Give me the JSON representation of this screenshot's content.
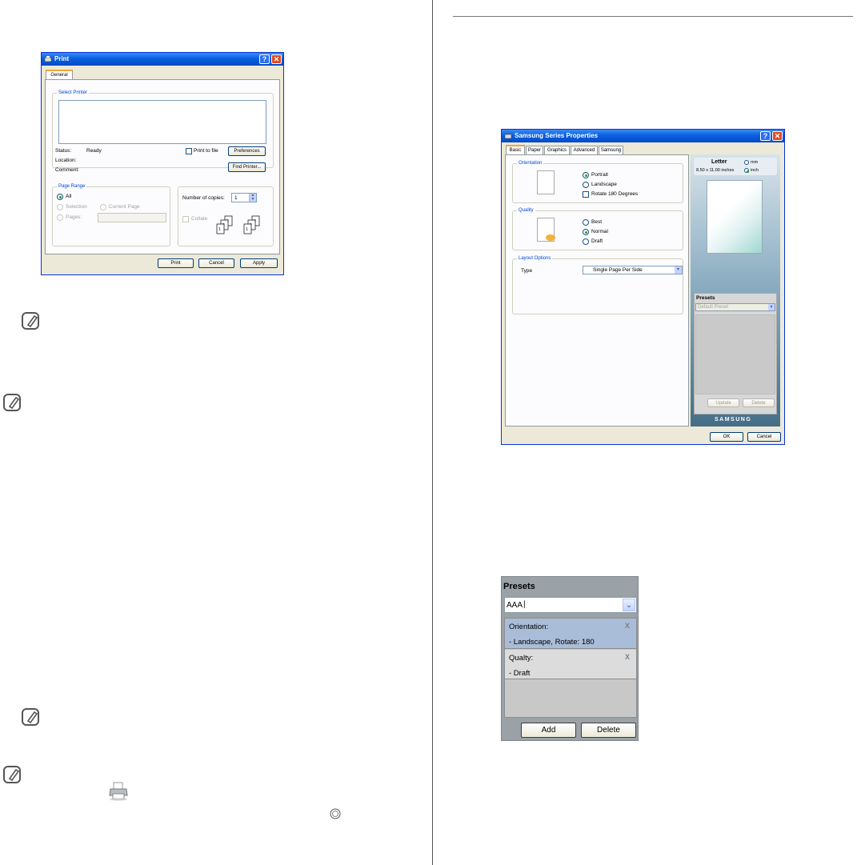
{
  "print_dialog": {
    "title": "Print",
    "tab_general": "General",
    "select_printer_label": "Select Printer",
    "status_label": "Status:",
    "status_value": "Ready",
    "location_label": "Location:",
    "comment_label": "Comment:",
    "print_to_file": "Print to file",
    "preferences_button": "Preferences",
    "find_printer_button": "Find Printer...",
    "page_range_label": "Page Range",
    "range_all": "All",
    "range_selection": "Selection",
    "range_current_page": "Current Page",
    "range_pages": "Pages:",
    "copies_label": "Number of copies:",
    "copies_value": "1",
    "collate_label": "Collate",
    "print_button": "Print",
    "cancel_button": "Cancel",
    "apply_button": "Apply"
  },
  "properties_dialog": {
    "title": "Samsung  Series Properties",
    "tabs": [
      "Basic",
      "Paper",
      "Graphics",
      "Advanced",
      "Samsung"
    ],
    "orientation_label": "Orientation",
    "portrait": "Portrait",
    "landscape": "Landscape",
    "rotate": "Rotate 180 Degrees",
    "quality_label": "Quality",
    "best": "Best",
    "normal": "Normal",
    "draft": "Draft",
    "layout_label": "Layout Options",
    "type_label": "Type",
    "type_value": "Single Page Per Side",
    "paper_name": "Letter",
    "paper_size": "8.50 x 11.00 inches",
    "unit_mm": "mm",
    "unit_inch": "inch",
    "presets_label": "Presets",
    "preset_value": "Default Preset",
    "update_button": "Update",
    "delete_button": "Delete",
    "brand": "SAMSUNG",
    "ok_button": "OK",
    "cancel_button": "Cancel"
  },
  "presets_zoom": {
    "title": "Presets",
    "input_value": "AAA",
    "items": [
      {
        "label": "Orientation:",
        "value": "- Landscape, Rotate: 180"
      },
      {
        "label": "Qualty:",
        "value": "- Draft"
      }
    ],
    "remove_glyph": "X",
    "add_button": "Add",
    "delete_button": "Delete"
  },
  "colors": {
    "xp_title_blue": "#0553d1",
    "xp_face": "#ece9d8",
    "selected_row": "#a9bcd8"
  },
  "icons": [
    "note-icon",
    "printer-icon",
    "help-icon",
    "close-icon",
    "dropdown-arrow-icon",
    "spinner-icon",
    "stop-button-icon"
  ]
}
